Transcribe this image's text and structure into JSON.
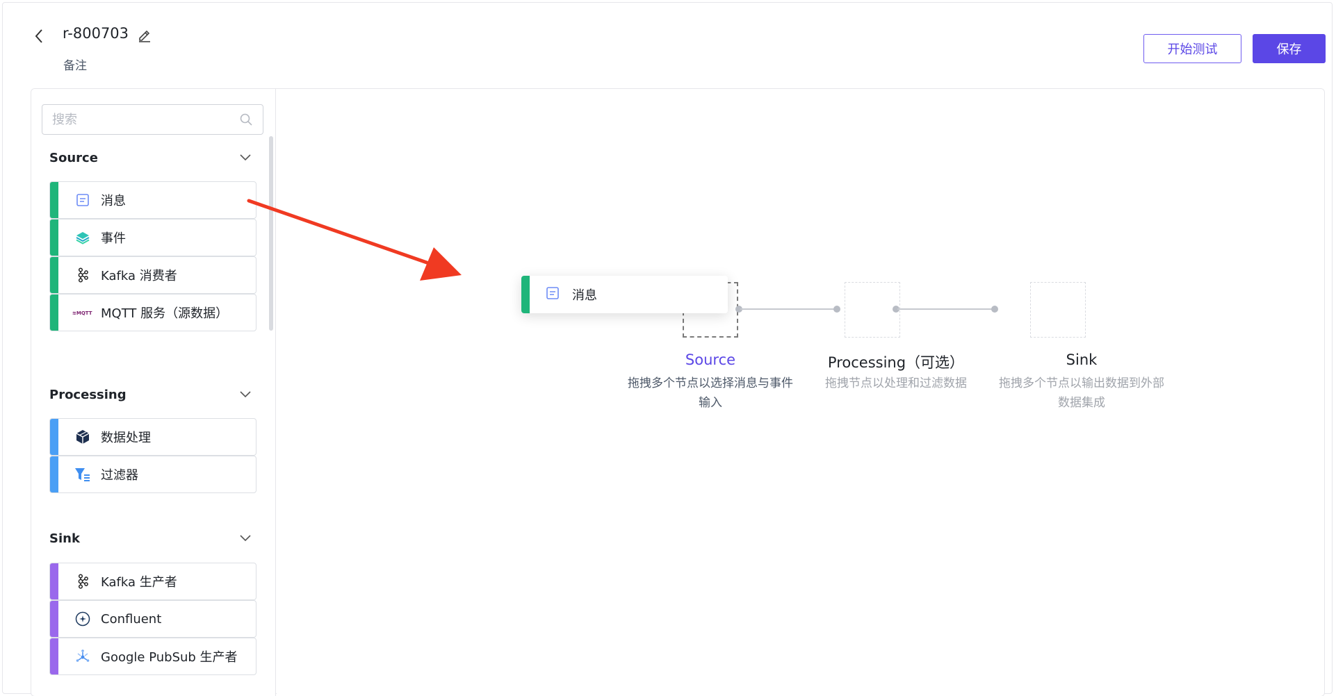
{
  "header": {
    "title": "r-800703",
    "subtitle": "备注",
    "test_button": "开始测试",
    "save_button": "保存"
  },
  "sidebar": {
    "search_placeholder": "搜索",
    "sections": [
      {
        "title": "Source",
        "items": [
          {
            "label": "消息",
            "icon": "message-icon"
          },
          {
            "label": "事件",
            "icon": "layers-icon"
          },
          {
            "label": "Kafka 消费者",
            "icon": "kafka-icon"
          },
          {
            "label": "MQTT 服务（源数据）",
            "icon": "mqtt-logo-icon",
            "logo_text": "MQTT"
          }
        ]
      },
      {
        "title": "Processing",
        "items": [
          {
            "label": "数据处理",
            "icon": "cube-icon"
          },
          {
            "label": "过滤器",
            "icon": "filter-icon"
          }
        ]
      },
      {
        "title": "Sink",
        "items": [
          {
            "label": "Kafka 生产者",
            "icon": "kafka-icon"
          },
          {
            "label": "Confluent",
            "icon": "confluent-icon"
          },
          {
            "label": "Google PubSub 生产者",
            "icon": "pubsub-icon"
          }
        ]
      }
    ]
  },
  "canvas": {
    "dragging_node": {
      "label": "消息",
      "icon": "message-icon"
    },
    "stages": [
      {
        "title": "Source",
        "description": "拖拽多个节点以选择消息与事件输入",
        "active": true
      },
      {
        "title": "Processing（可选）",
        "description": "拖拽节点以处理和过滤数据",
        "active": false
      },
      {
        "title": "Sink",
        "description": "拖拽多个节点以输出数据到外部数据集成",
        "active": false
      }
    ]
  },
  "colors": {
    "primary": "#5b47e6",
    "source": "#1fb57a",
    "processing": "#4a9ff5",
    "sink": "#9a68ec",
    "annotation_arrow": "#f03a22"
  }
}
